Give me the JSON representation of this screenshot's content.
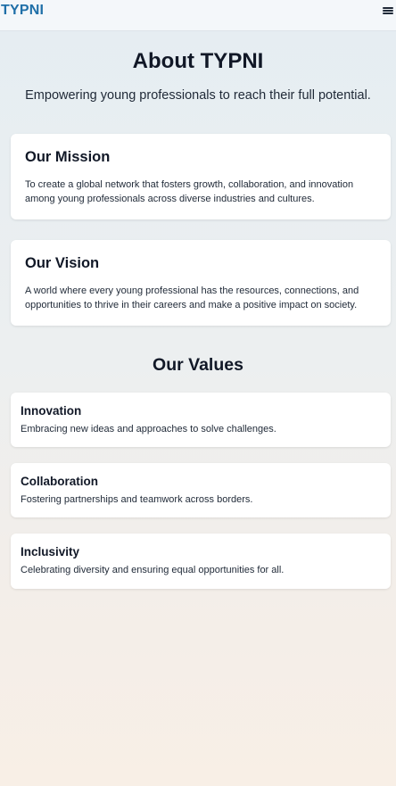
{
  "header": {
    "brand": "TYPNI",
    "menu_icon": "hamburger-icon"
  },
  "hero": {
    "title": "About TYPNI",
    "subtitle": "Empowering young professionals to reach their full potential."
  },
  "mission": {
    "heading": "Our Mission",
    "text": "To create a global network that fosters growth, collaboration, and innovation among young professionals across diverse industries and cultures."
  },
  "vision": {
    "heading": "Our Vision",
    "text": "A world where every young professional has the resources, connections, and opportunities to thrive in their careers and make a positive impact on society."
  },
  "values": {
    "heading": "Our Values",
    "items": [
      {
        "title": "Innovation",
        "text": "Embracing new ideas and approaches to solve challenges."
      },
      {
        "title": "Collaboration",
        "text": "Fostering partnerships and teamwork across borders."
      },
      {
        "title": "Inclusivity",
        "text": "Celebrating diversity and ensuring equal opportunities for all."
      }
    ]
  },
  "colors": {
    "brand": "#1f6fa8",
    "text": "#111827",
    "card": "#ffffff"
  }
}
